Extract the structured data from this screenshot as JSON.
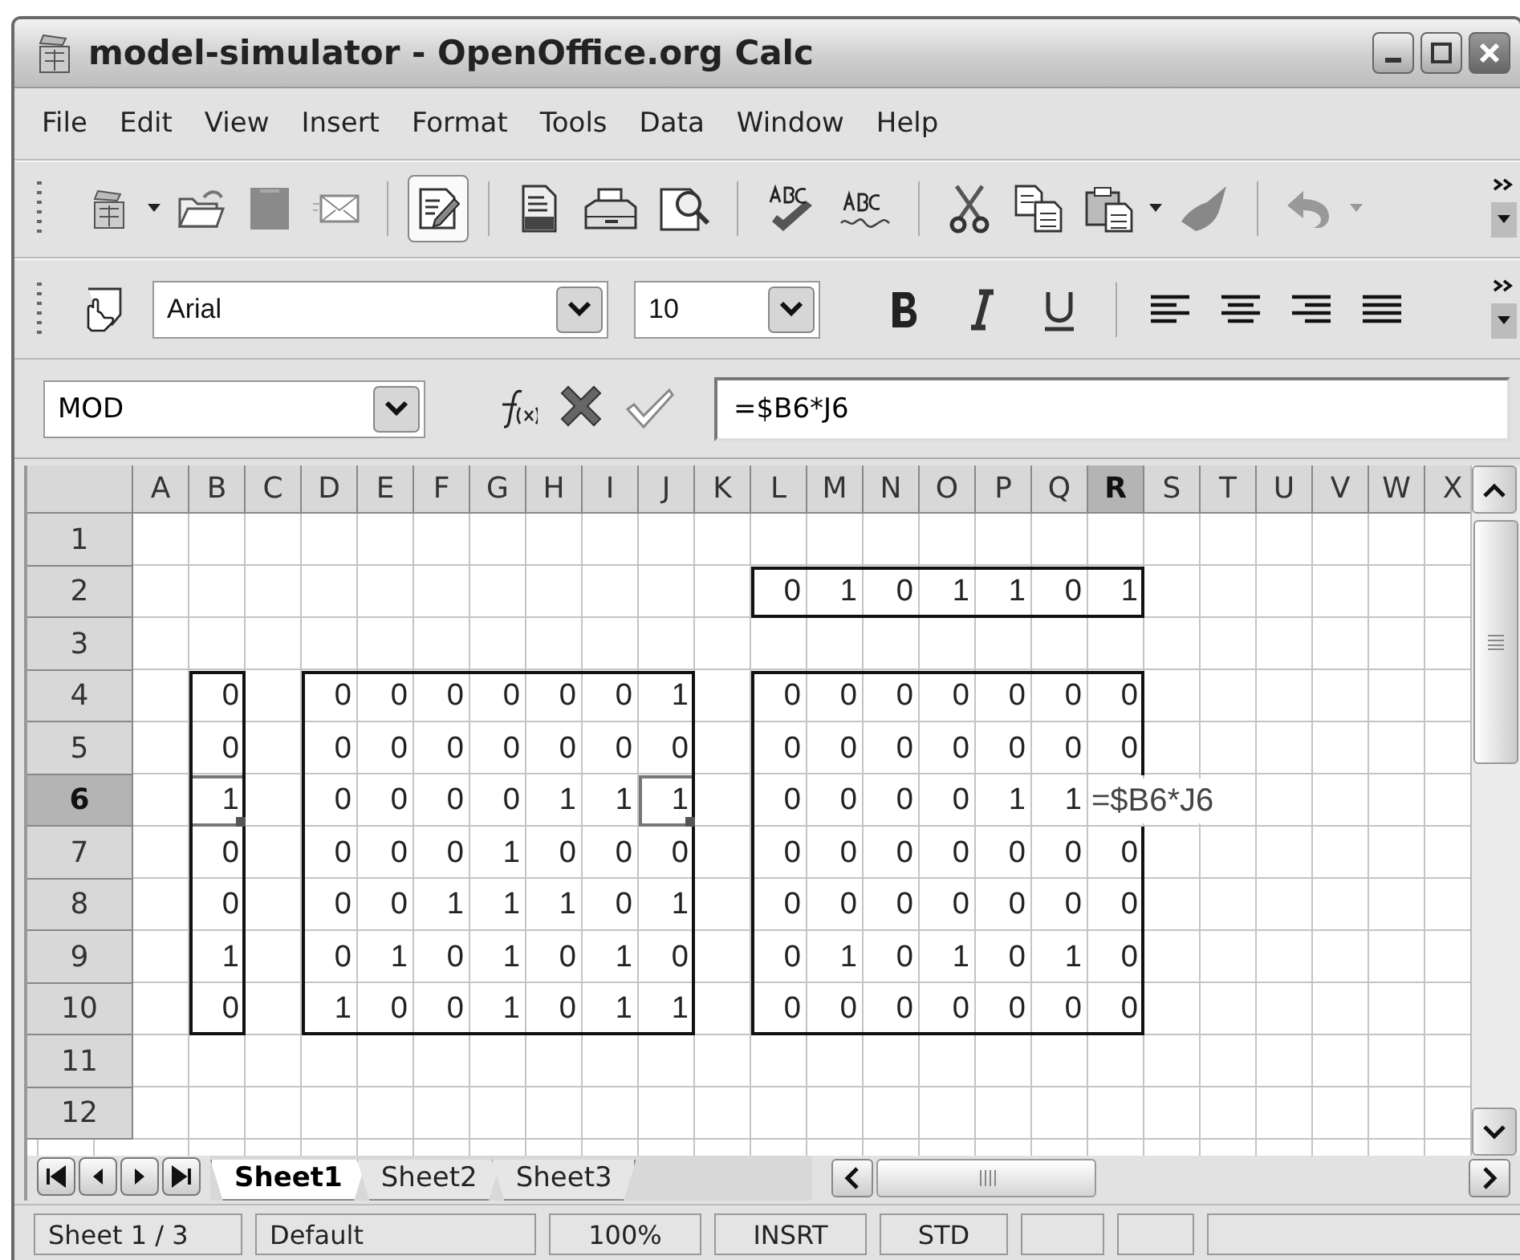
{
  "window": {
    "title": "model-simulator - OpenOffice.org Calc"
  },
  "menu": [
    {
      "label": "File"
    },
    {
      "label": "Edit"
    },
    {
      "label": "View"
    },
    {
      "label": "Insert"
    },
    {
      "label": "Format"
    },
    {
      "label": "Tools"
    },
    {
      "label": "Data"
    },
    {
      "label": "Window"
    },
    {
      "label": "Help"
    }
  ],
  "standard_toolbar": {
    "edit_mode_pressed": true
  },
  "formatting_toolbar": {
    "font_name": "Arial",
    "font_size": "10",
    "bold": false,
    "italic": false,
    "underline": false
  },
  "formula_bar": {
    "name_box": "MOD",
    "formula": "=$B6*J6"
  },
  "sheet": {
    "columns": [
      {
        "label": "A",
        "selected": false
      },
      {
        "label": "B",
        "selected": false
      },
      {
        "label": "C",
        "selected": false
      },
      {
        "label": "D",
        "selected": false
      },
      {
        "label": "E",
        "selected": false
      },
      {
        "label": "F",
        "selected": false
      },
      {
        "label": "G",
        "selected": false
      },
      {
        "label": "H",
        "selected": false
      },
      {
        "label": "I",
        "selected": false
      },
      {
        "label": "J",
        "selected": false
      },
      {
        "label": "K",
        "selected": false
      },
      {
        "label": "L",
        "selected": false
      },
      {
        "label": "M",
        "selected": false
      },
      {
        "label": "N",
        "selected": false
      },
      {
        "label": "O",
        "selected": false
      },
      {
        "label": "P",
        "selected": false
      },
      {
        "label": "Q",
        "selected": false
      },
      {
        "label": "R",
        "selected": true
      },
      {
        "label": "S",
        "selected": false
      },
      {
        "label": "T",
        "selected": false
      },
      {
        "label": "U",
        "selected": false
      },
      {
        "label": "V",
        "selected": false
      },
      {
        "label": "W",
        "selected": false
      },
      {
        "label": "X",
        "selected": false
      }
    ],
    "rows": [
      {
        "label": "1",
        "selected": false
      },
      {
        "label": "2",
        "selected": false,
        "cells": [
          null,
          null,
          null,
          null,
          null,
          null,
          null,
          null,
          null,
          null,
          null,
          "0",
          "1",
          "0",
          "1",
          "1",
          "0",
          "1"
        ]
      },
      {
        "label": "3",
        "selected": false
      },
      {
        "label": "4",
        "selected": false,
        "cells": [
          null,
          "0",
          null,
          "0",
          "0",
          "0",
          "0",
          "0",
          "0",
          "1",
          null,
          "0",
          "0",
          "0",
          "0",
          "0",
          "0",
          "0"
        ]
      },
      {
        "label": "5",
        "selected": false,
        "cells": [
          null,
          "0",
          null,
          "0",
          "0",
          "0",
          "0",
          "0",
          "0",
          "0",
          null,
          "0",
          "0",
          "0",
          "0",
          "0",
          "0",
          "0"
        ]
      },
      {
        "label": "6",
        "selected": true,
        "cells": [
          null,
          {
            "text": "1",
            "referenced": true
          },
          null,
          "0",
          "0",
          "0",
          "0",
          "1",
          "1",
          {
            "text": "1",
            "referenced": true
          },
          null,
          "0",
          "0",
          "0",
          "0",
          "1",
          "1",
          {
            "text": "=$B6*J6",
            "editing": true
          }
        ]
      },
      {
        "label": "7",
        "selected": false,
        "cells": [
          null,
          "0",
          null,
          "0",
          "0",
          "0",
          "1",
          "0",
          "0",
          "0",
          null,
          "0",
          "0",
          "0",
          "0",
          "0",
          "0",
          "0"
        ]
      },
      {
        "label": "8",
        "selected": false,
        "cells": [
          null,
          "0",
          null,
          "0",
          "0",
          "1",
          "1",
          "1",
          "0",
          "1",
          null,
          "0",
          "0",
          "0",
          "0",
          "0",
          "0",
          "0"
        ]
      },
      {
        "label": "9",
        "selected": false,
        "cells": [
          null,
          "1",
          null,
          "0",
          "1",
          "0",
          "1",
          "0",
          "1",
          "0",
          null,
          "0",
          "1",
          "0",
          "1",
          "0",
          "1",
          "0"
        ]
      },
      {
        "label": "10",
        "selected": false,
        "cells": [
          null,
          "0",
          null,
          "1",
          "0",
          "0",
          "1",
          "0",
          "1",
          "1",
          null,
          "0",
          "0",
          "0",
          "0",
          "0",
          "0",
          "0"
        ]
      },
      {
        "label": "11",
        "selected": false
      },
      {
        "label": "12",
        "selected": false
      }
    ],
    "block_borders": true
  },
  "sheet_tabs": [
    {
      "label": "Sheet1",
      "selected": true
    },
    {
      "label": "Sheet2",
      "selected": false
    },
    {
      "label": "Sheet3",
      "selected": false
    }
  ],
  "status_bar": [
    "Sheet 1 / 3",
    "Default",
    "100%",
    "INSRT",
    "STD"
  ]
}
